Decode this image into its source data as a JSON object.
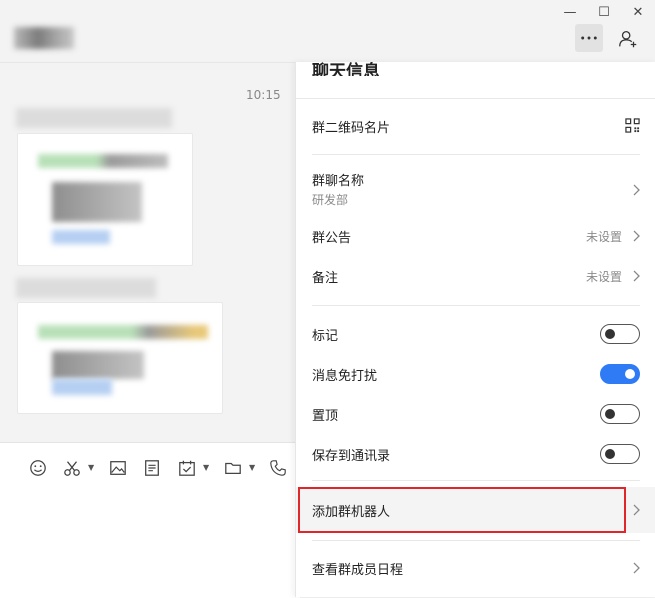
{
  "window_controls": {
    "minimize": "—",
    "maximize": "☐",
    "close": "✕"
  },
  "chat": {
    "time": "10:15"
  },
  "panel": {
    "title": "聊天信息",
    "qr_card": {
      "label": "群二维码名片"
    },
    "group_name": {
      "label": "群聊名称",
      "value": "研发部"
    },
    "announcement": {
      "label": "群公告",
      "value": "未设置"
    },
    "remark": {
      "label": "备注",
      "value": "未设置"
    },
    "toggles": [
      {
        "label": "标记",
        "on": false
      },
      {
        "label": "消息免打扰",
        "on": true
      },
      {
        "label": "置顶",
        "on": false
      },
      {
        "label": "保存到通讯录",
        "on": false
      }
    ],
    "add_robot": {
      "label": "添加群机器人"
    },
    "member_schedule": {
      "label": "查看群成员日程"
    }
  },
  "colors": {
    "accent": "#2f7bf6",
    "highlight_border": "#e0262a"
  }
}
